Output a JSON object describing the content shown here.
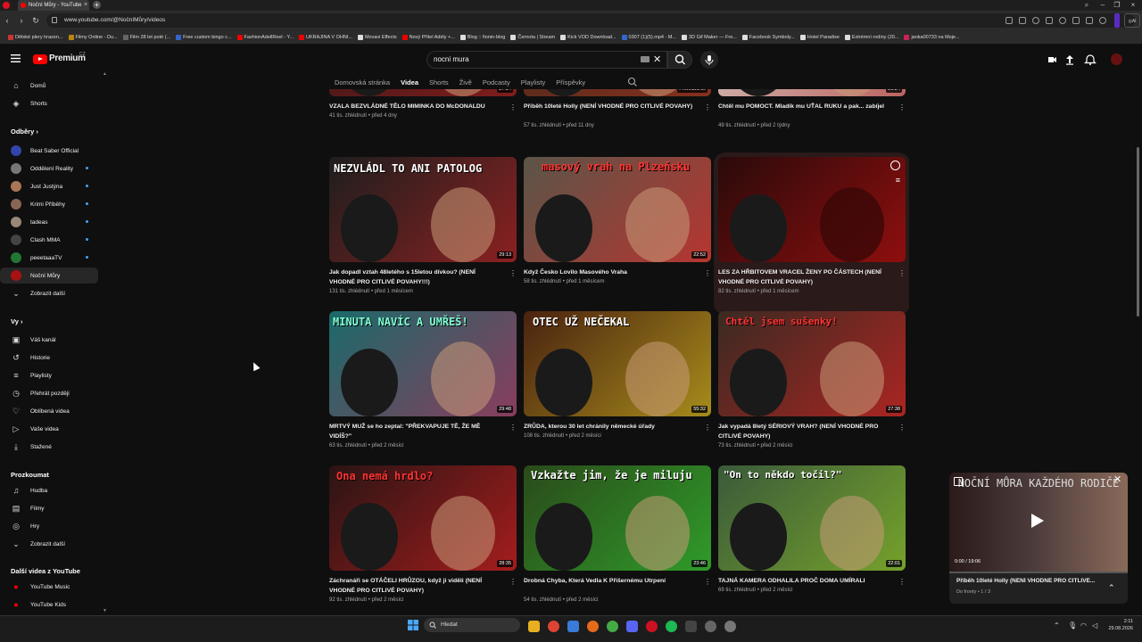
{
  "browser": {
    "tab_title": "Noční Můry - YouTube",
    "url": "www.youtube.com/@NočníMůry/videos",
    "bookmarks": [
      {
        "label": "Dětské plery hrazen...",
        "color": "#cc3333"
      },
      {
        "label": "Filmy Online - Du...",
        "color": "#b8860b"
      },
      {
        "label": "Film 28 let poté (...",
        "color": "#666666"
      },
      {
        "label": "Free custom bingo c...",
        "color": "#3366cc"
      },
      {
        "label": "FashionAdellReel - Y...",
        "color": "#ee0000"
      },
      {
        "label": "UKRAJINA V OHNI...",
        "color": "#ee0000"
      },
      {
        "label": "Movavi Effects",
        "color": "#dddddd"
      },
      {
        "label": "Nový Přítel Adély +...",
        "color": "#ee0000"
      },
      {
        "label": "Blog :: fionin-blog",
        "color": "#dddddd"
      },
      {
        "label": "Černota | Stream",
        "color": "#dddddd"
      },
      {
        "label": "Kick VOD Download...",
        "color": "#dddddd"
      },
      {
        "label": "0307 (1)(5).mp4 - M...",
        "color": "#3366cc"
      },
      {
        "label": "3D Gif Maker — Fre...",
        "color": "#dddddd"
      },
      {
        "label": "Facebook Symboly...",
        "color": "#dddddd"
      },
      {
        "label": "Hotel Paradise",
        "color": "#dddddd"
      },
      {
        "label": "Extrémní rodiny (20...",
        "color": "#dddddd"
      },
      {
        "label": "janka00733 na Moje...",
        "color": "#cc2255"
      }
    ]
  },
  "header": {
    "brand": "Premium",
    "country": "CZ",
    "search_value": "nocni mura"
  },
  "channel_tabs": [
    {
      "label": "Domovská stránka",
      "active": false
    },
    {
      "label": "Videa",
      "active": true
    },
    {
      "label": "Shorts",
      "active": false
    },
    {
      "label": "Živě",
      "active": false
    },
    {
      "label": "Podcasty",
      "active": false
    },
    {
      "label": "Playlisty",
      "active": false
    },
    {
      "label": "Příspěvky",
      "active": false
    }
  ],
  "sidebar": {
    "main": [
      {
        "label": "Domů",
        "icon": "home-icon"
      },
      {
        "label": "Shorts",
        "icon": "shorts-icon"
      }
    ],
    "subs_heading": "Odběry",
    "subs": [
      {
        "label": "Beat Saber Official",
        "color": "#3344aa",
        "dot": false
      },
      {
        "label": "Oddělení Reality",
        "color": "#777777",
        "dot": true
      },
      {
        "label": "Just Justýna",
        "color": "#aa7755",
        "dot": true
      },
      {
        "label": "Krimi Příběhy",
        "color": "#886655",
        "dot": true
      },
      {
        "label": "tadeas",
        "color": "#998877",
        "dot": true
      },
      {
        "label": "Clash MMA",
        "color": "#444444",
        "dot": true
      },
      {
        "label": "peeetaaaTV",
        "color": "#227733",
        "dot": true
      },
      {
        "label": "Noční Můry",
        "color": "#aa1111",
        "dot": false,
        "active": true
      },
      {
        "label": "Zobrazit další",
        "color": "",
        "dot": false
      }
    ],
    "you_heading": "Vy",
    "you": [
      {
        "label": "Váš kanál",
        "icon": "account-icon"
      },
      {
        "label": "Historie",
        "icon": "history-icon"
      },
      {
        "label": "Playlisty",
        "icon": "playlist-icon"
      },
      {
        "label": "Přehrát později",
        "icon": "clock-icon"
      },
      {
        "label": "Oblíbená videa",
        "icon": "like-icon"
      },
      {
        "label": "Vaše videa",
        "icon": "video-icon"
      },
      {
        "label": "Stažené",
        "icon": "download-icon"
      }
    ],
    "explore_heading": "Prozkoumat",
    "explore": [
      {
        "label": "Hudba",
        "icon": "music-icon"
      },
      {
        "label": "Filmy",
        "icon": "film-icon"
      },
      {
        "label": "Hry",
        "icon": "gamepad-icon"
      },
      {
        "label": "Zobrazit další",
        "icon": "chevron-down-icon"
      }
    ],
    "more_heading": "Další videa z YouTube",
    "more": [
      {
        "label": "YouTube Music",
        "icon": "yt-music-icon"
      },
      {
        "label": "YouTube Kids",
        "icon": "yt-kids-icon"
      }
    ]
  },
  "videos": [
    {
      "title": "VZALA BEZVLÁDNÉ TĚLO MIMINKA DO McDONALDU",
      "views": "41 tis. zhlédnutí",
      "age": "před 4 dny",
      "duration": "27:54",
      "overlay": "",
      "bg": "#3a1616",
      "accent": "#aa2222"
    },
    {
      "title": "Příběh 10leté Holly (NENÍ VHODNÉ PRO CITLIVÉ POVAHY)",
      "views": "57 tis. zhlédnutí",
      "age": "před 11 dny",
      "duration": "Přehrává se",
      "overlay": "",
      "bg": "#4a2a1a",
      "accent": "#aa3322"
    },
    {
      "title": "Chtěl mu POMOCT. Mladík mu UŤAL RUKU a pak... zabíjel",
      "views": "49 tis. zhlédnutí",
      "age": "před 2 týdny",
      "duration": "29:24",
      "overlay": "",
      "bg": "#d8d0c8",
      "accent": "#aa2222"
    },
    {
      "title": "Jak dopadl vztah 48letého s 15letou dívkou? (NENÍ VHODNÉ PRO CITLIVÉ POVAHY!!!)",
      "views": "131 tis. zhlédnutí",
      "age": "před 1 měsícem",
      "duration": "29:13",
      "overlay": "NEZVLÁDL TO ANI PATOLOG",
      "bg": "#1e1e1e",
      "accent": "#cc2222"
    },
    {
      "title": "Když Česko Lovilo Masového Vraha",
      "views": "58 tis. zhlédnutí",
      "age": "před 1 měsícem",
      "duration": "22:52",
      "overlay": "masový vrah na Plzeňsku",
      "bg": "#5a5548",
      "accent": "#ee2222"
    },
    {
      "title": "LES ZA HŘBITOVEM VRACEL ŽENY PO ČÁSTECH (NENÍ VHODNÉ PRO CITLIVÉ POVAHY)",
      "views": "82 tis. zhlédnutí",
      "age": "před 1 měsícem",
      "duration": "",
      "overlay": "",
      "bg": "#2a0a0a",
      "accent": "#cc1111"
    },
    {
      "title": "MRTVÝ MUŽ se ho zeptal: \"PŘEKVAPUJE TĚ, ŽE MĚ VIDÍŠ?\"",
      "views": "63 tis. zhlédnutí",
      "age": "před 2 měsíci",
      "duration": "29:48",
      "overlay": "MINUTA NAVÍC A UMŘEŠ!",
      "bg": "#1a6a6a",
      "accent": "#cc2255"
    },
    {
      "title": "ZRŮDA, kterou 30 let chránily německé úřady",
      "views": "108 tis. zhlédnutí",
      "age": "před 2 měsíci",
      "duration": "55:32",
      "overlay": "OTEC UŽ NEČEKAL",
      "bg": "#4a2210",
      "accent": "#ddcc22"
    },
    {
      "title": "Jak vypadá 8letý SÉRIOVÝ VRAH? (NENÍ VHODNÉ PRO CITLIVÉ POVAHY)",
      "views": "73 tis. zhlédnutí",
      "age": "před 2 měsíci",
      "duration": "27:38",
      "overlay": "Chtěl jsem sušenky!",
      "bg": "#3a2a22",
      "accent": "#ee2222"
    },
    {
      "title": "Záchranáři se OTÁČELI HRŮZOU, když ji viděli (NENÍ VHODNÉ PRO CITLIVÉ POVAHY)",
      "views": "92 tis. zhlédnutí",
      "age": "před 2 měsíci",
      "duration": "28:35",
      "overlay": "Ona nemá hrdlo?",
      "bg": "#2a1414",
      "accent": "#ee2222"
    },
    {
      "title": "Drobná Chyba, Která Vedla K Přišernému Utrpení",
      "views": "54 tis. zhlédnutí",
      "age": "před 2 měsíci",
      "duration": "23:46",
      "overlay": "Vzkažte jim, že je miluju",
      "bg": "#2a4a1a",
      "accent": "#33cc33"
    },
    {
      "title": "TAJNÁ KAMERA ODHALILA PROČ DOMA UMÍRALI",
      "views": "69 tis. zhlédnutí",
      "age": "před 2 měsíci",
      "duration": "22:01",
      "overlay": "\"On to někdo točil?\"",
      "bg": "#3a5a3a",
      "accent": "#99cc22"
    }
  ],
  "miniplayer": {
    "title": "Příběh 10leté Holly (NENÍ VHODNÉ PRO CITLIVÉ...",
    "queue": "Do fronty • 1 / 3",
    "time": "0:00 / 19:06",
    "overlay": "NOČNÍ MŮRA KAŽDÉHO RODIČE"
  },
  "taskbar": {
    "search_placeholder": "Hledat",
    "time": "2:11",
    "date": "29.08.2026"
  }
}
